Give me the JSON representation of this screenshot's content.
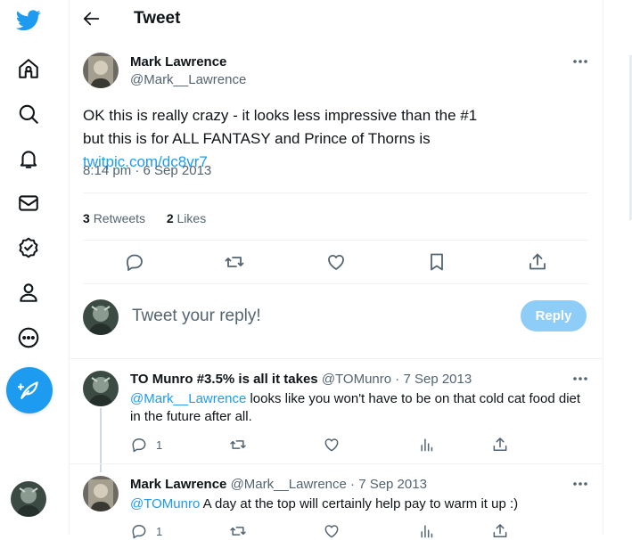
{
  "header": {
    "title": "Tweet"
  },
  "tweet": {
    "author_name": "Mark Lawrence",
    "author_handle": "@Mark__Lawrence",
    "text_before": "OK this is really crazy - it looks less impressive than the #1 but this is for ALL FANTASY and Prince of Thorns is ",
    "link_text": "twitpic.com/dc8vr7",
    "timestamp": "8:14 pm · 6 Sep 2013",
    "retweets_count": "3",
    "retweets_label": "Retweets",
    "likes_count": "2",
    "likes_label": "Likes"
  },
  "reply_box": {
    "placeholder": "Tweet your reply!",
    "button_label": "Reply"
  },
  "replies": [
    {
      "author_name": "TO Munro #3.5% is all it takes",
      "author_handle": "@TOMunro",
      "date": "· 7 Sep 2013",
      "mention": "@Mark__Lawrence",
      "text": " looks like you won't have to be on that cold cat food diet in the future after all.",
      "reply_count": "1"
    },
    {
      "author_name": "Mark Lawrence",
      "author_handle": "@Mark__Lawrence",
      "date": "· 7 Sep 2013",
      "mention": "@TOMunro",
      "text": " A day at the top will certainly help pay to warm it up  :)",
      "reply_count": "1"
    }
  ],
  "nav_icons": [
    "twitter-logo-icon",
    "home-icon",
    "explore-icon",
    "notifications-icon",
    "messages-icon",
    "verified-icon",
    "profile-icon",
    "more-icon",
    "compose-icon"
  ],
  "colors": {
    "accent": "#1d9bf0",
    "reply_button_disabled": "#8ecdf7",
    "text_secondary": "#536471"
  }
}
